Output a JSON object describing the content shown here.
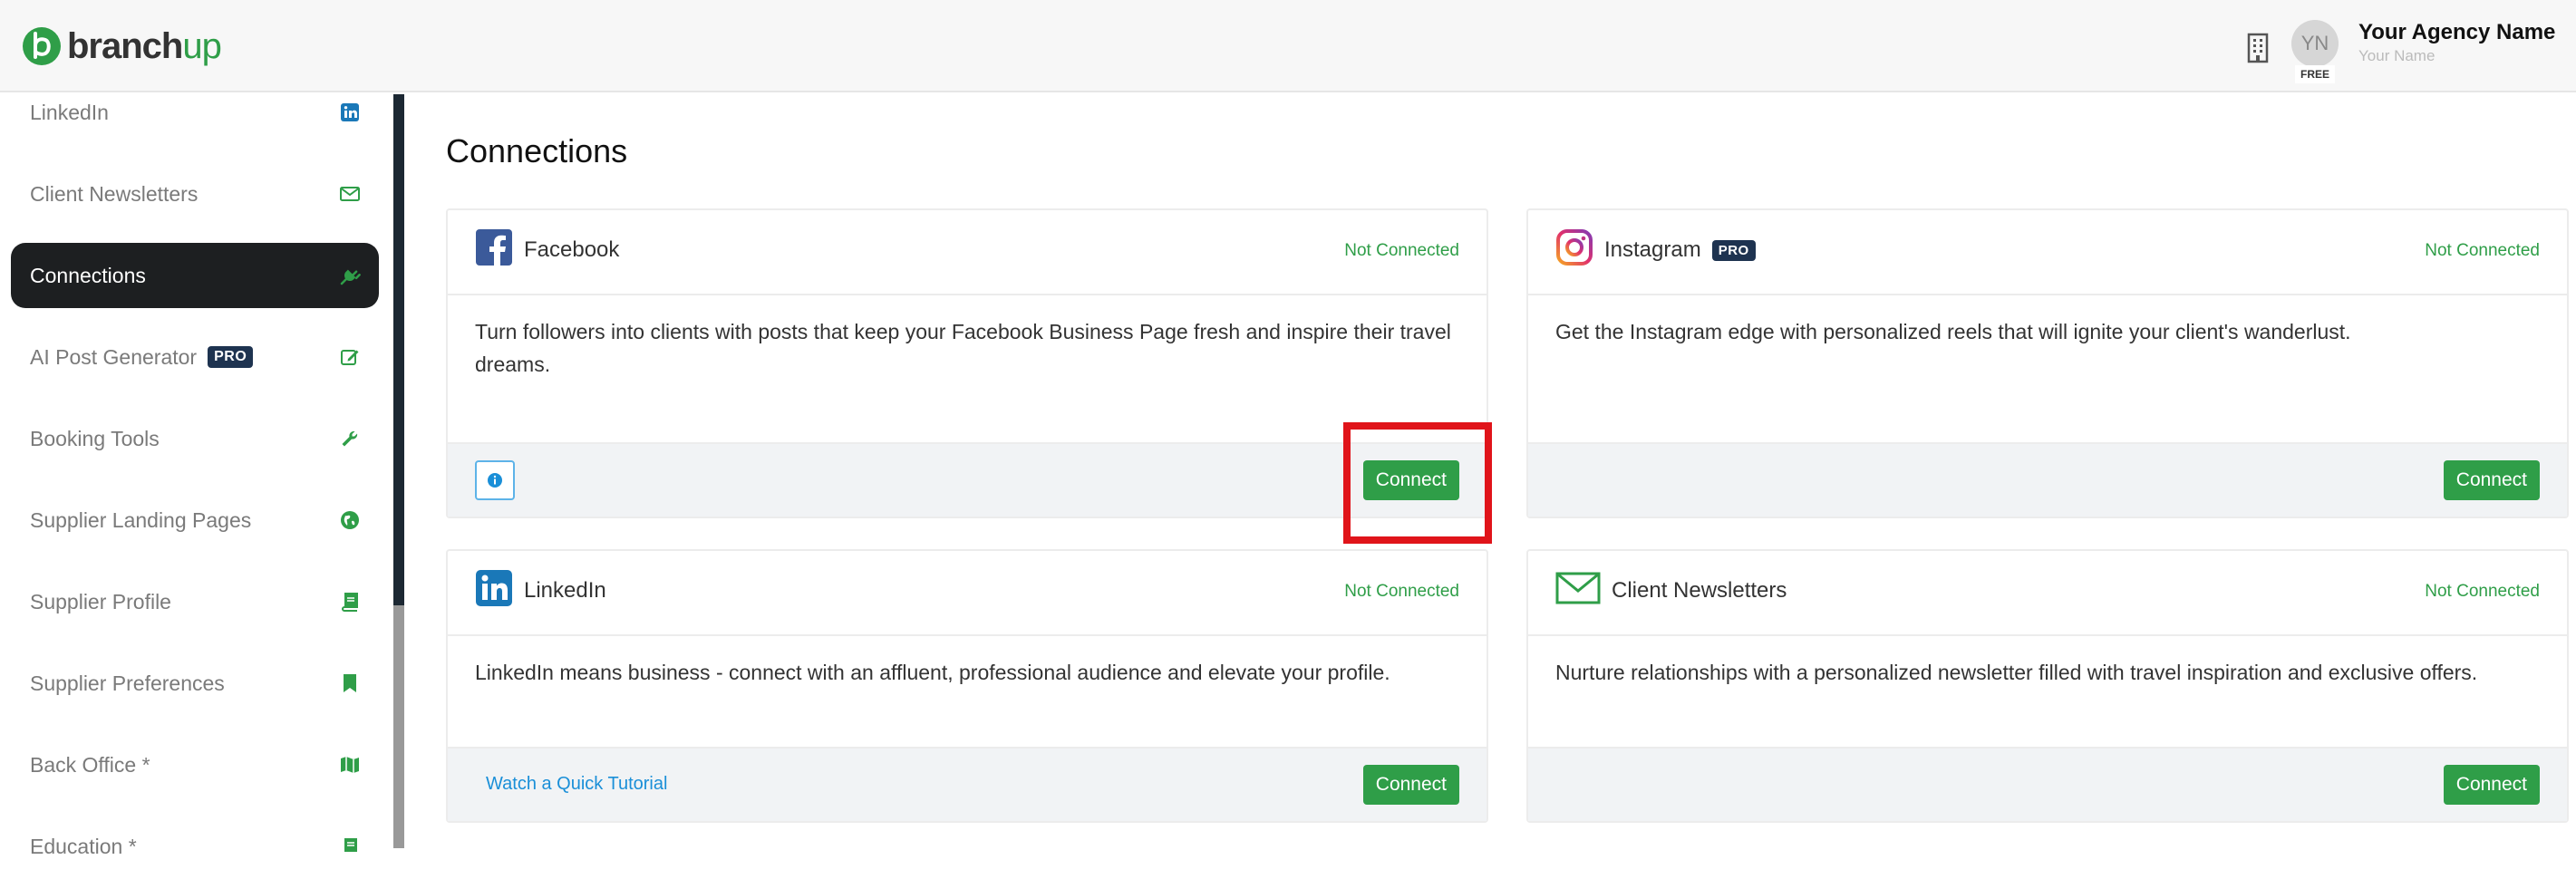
{
  "header": {
    "logo_main": "branch",
    "logo_accent": "up",
    "avatar_initials": "YN",
    "plan_badge": "FREE",
    "agency_name": "Your Agency Name",
    "user_name": "Your Name"
  },
  "sidebar": {
    "items": [
      {
        "label": "LinkedIn",
        "icon": "linkedin-icon"
      },
      {
        "label": "Client Newsletters",
        "icon": "envelope-icon"
      },
      {
        "label": "Connections",
        "icon": "plug-icon",
        "active": true
      },
      {
        "label": "AI Post Generator",
        "icon": "edit-icon",
        "badge": "PRO"
      },
      {
        "label": "Booking Tools",
        "icon": "wrench-icon"
      },
      {
        "label": "Supplier Landing Pages",
        "icon": "globe-icon"
      },
      {
        "label": "Supplier Profile",
        "icon": "book-icon"
      },
      {
        "label": "Supplier Preferences",
        "icon": "bookmark-icon"
      },
      {
        "label": "Back Office *",
        "icon": "map-icon"
      },
      {
        "label": "Education *",
        "icon": "book-icon"
      }
    ]
  },
  "main": {
    "title": "Connections",
    "cards": {
      "facebook": {
        "title": "Facebook",
        "status": "Not Connected",
        "description": "Turn followers into clients with posts that keep your Facebook Business Page fresh and inspire their travel dreams.",
        "button": "Connect"
      },
      "instagram": {
        "title": "Instagram",
        "badge": "PRO",
        "status": "Not Connected",
        "description": "Get the Instagram edge with personalized reels that will ignite your client's wanderlust.",
        "button": "Connect"
      },
      "linkedin": {
        "title": "LinkedIn",
        "status": "Not Connected",
        "description": "LinkedIn means business - connect with an affluent, professional audience and elevate your profile.",
        "link": "Watch a Quick Tutorial",
        "button": "Connect"
      },
      "newsletters": {
        "title": "Client Newsletters",
        "status": "Not Connected",
        "description": "Nurture relationships with a personalized newsletter filled with travel inspiration and exclusive offers.",
        "button": "Connect"
      }
    }
  },
  "colors": {
    "brand_green": "#2f9e48",
    "pro_badge": "#1e3350",
    "sidebar_active": "#1d1f21",
    "highlight": "#e0141a",
    "link": "#1a8fd8"
  }
}
